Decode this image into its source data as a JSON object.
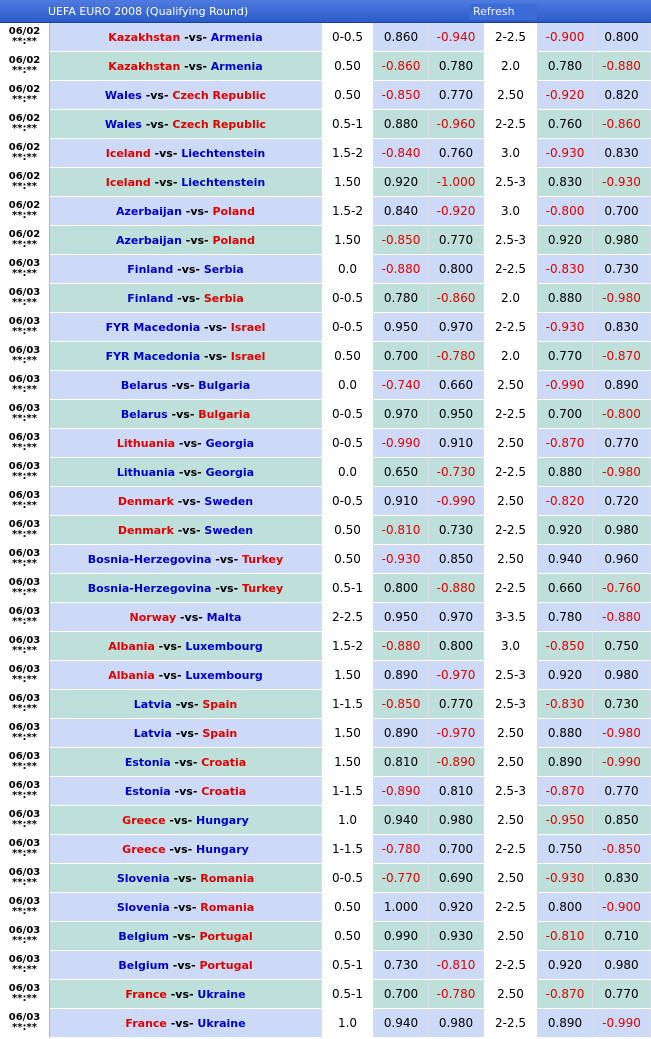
{
  "header": {
    "title": "UEFA EURO 2008 (Qualifying Round)",
    "refresh_label": "Refresh"
  },
  "colors": {
    "home_red": "#e00000",
    "home_blue": "#0000cc",
    "negative": "#e00000",
    "row_blue": "#ccd9f7",
    "row_green": "#bfe0da",
    "title_bar": "#3d6bd8"
  },
  "vs_text": "-vs-",
  "time_text": "**:**",
  "rows": [
    {
      "date": "06/02",
      "home": "Kazakhstan",
      "home_color": "red",
      "away": "Armenia",
      "away_color": "blue",
      "hcap": "0-0.5",
      "h1": "0.860",
      "h2": "-0.940",
      "ou": "2-2.5",
      "o1": "-0.900",
      "o2": "0.800"
    },
    {
      "date": "06/02",
      "home": "Kazakhstan",
      "home_color": "red",
      "away": "Armenia",
      "away_color": "blue",
      "hcap": "0.50",
      "h1": "-0.860",
      "h2": "0.780",
      "ou": "2.0",
      "o1": "0.780",
      "o2": "-0.880"
    },
    {
      "date": "06/02",
      "home": "Wales",
      "home_color": "blue",
      "away": "Czech Republic",
      "away_color": "red",
      "hcap": "0.50",
      "h1": "-0.850",
      "h2": "0.770",
      "ou": "2.50",
      "o1": "-0.920",
      "o2": "0.820"
    },
    {
      "date": "06/02",
      "home": "Wales",
      "home_color": "blue",
      "away": "Czech Republic",
      "away_color": "red",
      "hcap": "0.5-1",
      "h1": "0.880",
      "h2": "-0.960",
      "ou": "2-2.5",
      "o1": "0.760",
      "o2": "-0.860"
    },
    {
      "date": "06/02",
      "home": "Iceland",
      "home_color": "red",
      "away": "Liechtenstein",
      "away_color": "blue",
      "hcap": "1.5-2",
      "h1": "-0.840",
      "h2": "0.760",
      "ou": "3.0",
      "o1": "-0.930",
      "o2": "0.830"
    },
    {
      "date": "06/02",
      "home": "Iceland",
      "home_color": "red",
      "away": "Liechtenstein",
      "away_color": "blue",
      "hcap": "1.50",
      "h1": "0.920",
      "h2": "-1.000",
      "ou": "2.5-3",
      "o1": "0.830",
      "o2": "-0.930"
    },
    {
      "date": "06/02",
      "home": "Azerbaijan",
      "home_color": "blue",
      "away": "Poland",
      "away_color": "red",
      "hcap": "1.5-2",
      "h1": "0.840",
      "h2": "-0.920",
      "ou": "3.0",
      "o1": "-0.800",
      "o2": "0.700"
    },
    {
      "date": "06/02",
      "home": "Azerbaijan",
      "home_color": "blue",
      "away": "Poland",
      "away_color": "red",
      "hcap": "1.50",
      "h1": "-0.850",
      "h2": "0.770",
      "ou": "2.5-3",
      "o1": "0.920",
      "o2": "0.980"
    },
    {
      "date": "06/03",
      "home": "Finland",
      "home_color": "blue",
      "away": "Serbia",
      "away_color": "blue",
      "hcap": "0.0",
      "h1": "-0.880",
      "h2": "0.800",
      "ou": "2-2.5",
      "o1": "-0.830",
      "o2": "0.730"
    },
    {
      "date": "06/03",
      "home": "Finland",
      "home_color": "blue",
      "away": "Serbia",
      "away_color": "red",
      "hcap": "0-0.5",
      "h1": "0.780",
      "h2": "-0.860",
      "ou": "2.0",
      "o1": "0.880",
      "o2": "-0.980"
    },
    {
      "date": "06/03",
      "home": "FYR Macedonia",
      "home_color": "blue",
      "away": "Israel",
      "away_color": "red",
      "hcap": "0-0.5",
      "h1": "0.950",
      "h2": "0.970",
      "ou": "2-2.5",
      "o1": "-0.930",
      "o2": "0.830"
    },
    {
      "date": "06/03",
      "home": "FYR Macedonia",
      "home_color": "blue",
      "away": "Israel",
      "away_color": "red",
      "hcap": "0.50",
      "h1": "0.700",
      "h2": "-0.780",
      "ou": "2.0",
      "o1": "0.770",
      "o2": "-0.870"
    },
    {
      "date": "06/03",
      "home": "Belarus",
      "home_color": "blue",
      "away": "Bulgaria",
      "away_color": "blue",
      "hcap": "0.0",
      "h1": "-0.740",
      "h2": "0.660",
      "ou": "2.50",
      "o1": "-0.990",
      "o2": "0.890"
    },
    {
      "date": "06/03",
      "home": "Belarus",
      "home_color": "blue",
      "away": "Bulgaria",
      "away_color": "red",
      "hcap": "0-0.5",
      "h1": "0.970",
      "h2": "0.950",
      "ou": "2-2.5",
      "o1": "0.700",
      "o2": "-0.800"
    },
    {
      "date": "06/03",
      "home": "Lithuania",
      "home_color": "red",
      "away": "Georgia",
      "away_color": "blue",
      "hcap": "0-0.5",
      "h1": "-0.990",
      "h2": "0.910",
      "ou": "2.50",
      "o1": "-0.870",
      "o2": "0.770"
    },
    {
      "date": "06/03",
      "home": "Lithuania",
      "home_color": "blue",
      "away": "Georgia",
      "away_color": "blue",
      "hcap": "0.0",
      "h1": "0.650",
      "h2": "-0.730",
      "ou": "2-2.5",
      "o1": "0.880",
      "o2": "-0.980"
    },
    {
      "date": "06/03",
      "home": "Denmark",
      "home_color": "red",
      "away": "Sweden",
      "away_color": "blue",
      "hcap": "0-0.5",
      "h1": "0.910",
      "h2": "-0.990",
      "ou": "2.50",
      "o1": "-0.820",
      "o2": "0.720"
    },
    {
      "date": "06/03",
      "home": "Denmark",
      "home_color": "red",
      "away": "Sweden",
      "away_color": "blue",
      "hcap": "0.50",
      "h1": "-0.810",
      "h2": "0.730",
      "ou": "2-2.5",
      "o1": "0.920",
      "o2": "0.980"
    },
    {
      "date": "06/03",
      "home": "Bosnia-Herzegovina",
      "home_color": "blue",
      "away": "Turkey",
      "away_color": "red",
      "hcap": "0.50",
      "h1": "-0.930",
      "h2": "0.850",
      "ou": "2.50",
      "o1": "0.940",
      "o2": "0.960"
    },
    {
      "date": "06/03",
      "home": "Bosnia-Herzegovina",
      "home_color": "blue",
      "away": "Turkey",
      "away_color": "red",
      "hcap": "0.5-1",
      "h1": "0.800",
      "h2": "-0.880",
      "ou": "2-2.5",
      "o1": "0.660",
      "o2": "-0.760"
    },
    {
      "date": "06/03",
      "home": "Norway",
      "home_color": "red",
      "away": "Malta",
      "away_color": "blue",
      "hcap": "2-2.5",
      "h1": "0.950",
      "h2": "0.970",
      "ou": "3-3.5",
      "o1": "0.780",
      "o2": "-0.880"
    },
    {
      "date": "06/03",
      "home": "Albania",
      "home_color": "red",
      "away": "Luxembourg",
      "away_color": "blue",
      "hcap": "1.5-2",
      "h1": "-0.880",
      "h2": "0.800",
      "ou": "3.0",
      "o1": "-0.850",
      "o2": "0.750"
    },
    {
      "date": "06/03",
      "home": "Albania",
      "home_color": "red",
      "away": "Luxembourg",
      "away_color": "blue",
      "hcap": "1.50",
      "h1": "0.890",
      "h2": "-0.970",
      "ou": "2.5-3",
      "o1": "0.920",
      "o2": "0.980"
    },
    {
      "date": "06/03",
      "home": "Latvia",
      "home_color": "blue",
      "away": "Spain",
      "away_color": "red",
      "hcap": "1-1.5",
      "h1": "-0.850",
      "h2": "0.770",
      "ou": "2.5-3",
      "o1": "-0.830",
      "o2": "0.730"
    },
    {
      "date": "06/03",
      "home": "Latvia",
      "home_color": "blue",
      "away": "Spain",
      "away_color": "red",
      "hcap": "1.50",
      "h1": "0.890",
      "h2": "-0.970",
      "ou": "2.50",
      "o1": "0.880",
      "o2": "-0.980"
    },
    {
      "date": "06/03",
      "home": "Estonia",
      "home_color": "blue",
      "away": "Croatia",
      "away_color": "red",
      "hcap": "1.50",
      "h1": "0.810",
      "h2": "-0.890",
      "ou": "2.50",
      "o1": "0.890",
      "o2": "-0.990"
    },
    {
      "date": "06/03",
      "home": "Estonia",
      "home_color": "blue",
      "away": "Croatia",
      "away_color": "red",
      "hcap": "1-1.5",
      "h1": "-0.890",
      "h2": "0.810",
      "ou": "2.5-3",
      "o1": "-0.870",
      "o2": "0.770"
    },
    {
      "date": "06/03",
      "home": "Greece",
      "home_color": "red",
      "away": "Hungary",
      "away_color": "blue",
      "hcap": "1.0",
      "h1": "0.940",
      "h2": "0.980",
      "ou": "2.50",
      "o1": "-0.950",
      "o2": "0.850"
    },
    {
      "date": "06/03",
      "home": "Greece",
      "home_color": "red",
      "away": "Hungary",
      "away_color": "blue",
      "hcap": "1-1.5",
      "h1": "-0.780",
      "h2": "0.700",
      "ou": "2-2.5",
      "o1": "0.750",
      "o2": "-0.850"
    },
    {
      "date": "06/03",
      "home": "Slovenia",
      "home_color": "blue",
      "away": "Romania",
      "away_color": "red",
      "hcap": "0-0.5",
      "h1": "-0.770",
      "h2": "0.690",
      "ou": "2.50",
      "o1": "-0.930",
      "o2": "0.830"
    },
    {
      "date": "06/03",
      "home": "Slovenia",
      "home_color": "blue",
      "away": "Romania",
      "away_color": "red",
      "hcap": "0.50",
      "h1": "1.000",
      "h2": "0.920",
      "ou": "2-2.5",
      "o1": "0.800",
      "o2": "-0.900"
    },
    {
      "date": "06/03",
      "home": "Belgium",
      "home_color": "blue",
      "away": "Portugal",
      "away_color": "red",
      "hcap": "0.50",
      "h1": "0.990",
      "h2": "0.930",
      "ou": "2.50",
      "o1": "-0.810",
      "o2": "0.710"
    },
    {
      "date": "06/03",
      "home": "Belgium",
      "home_color": "blue",
      "away": "Portugal",
      "away_color": "red",
      "hcap": "0.5-1",
      "h1": "0.730",
      "h2": "-0.810",
      "ou": "2-2.5",
      "o1": "0.920",
      "o2": "0.980"
    },
    {
      "date": "06/03",
      "home": "France",
      "home_color": "red",
      "away": "Ukraine",
      "away_color": "blue",
      "hcap": "0.5-1",
      "h1": "0.700",
      "h2": "-0.780",
      "ou": "2.50",
      "o1": "-0.870",
      "o2": "0.770"
    },
    {
      "date": "06/03",
      "home": "France",
      "home_color": "red",
      "away": "Ukraine",
      "away_color": "blue",
      "hcap": "1.0",
      "h1": "0.940",
      "h2": "0.980",
      "ou": "2-2.5",
      "o1": "0.890",
      "o2": "-0.990"
    }
  ]
}
